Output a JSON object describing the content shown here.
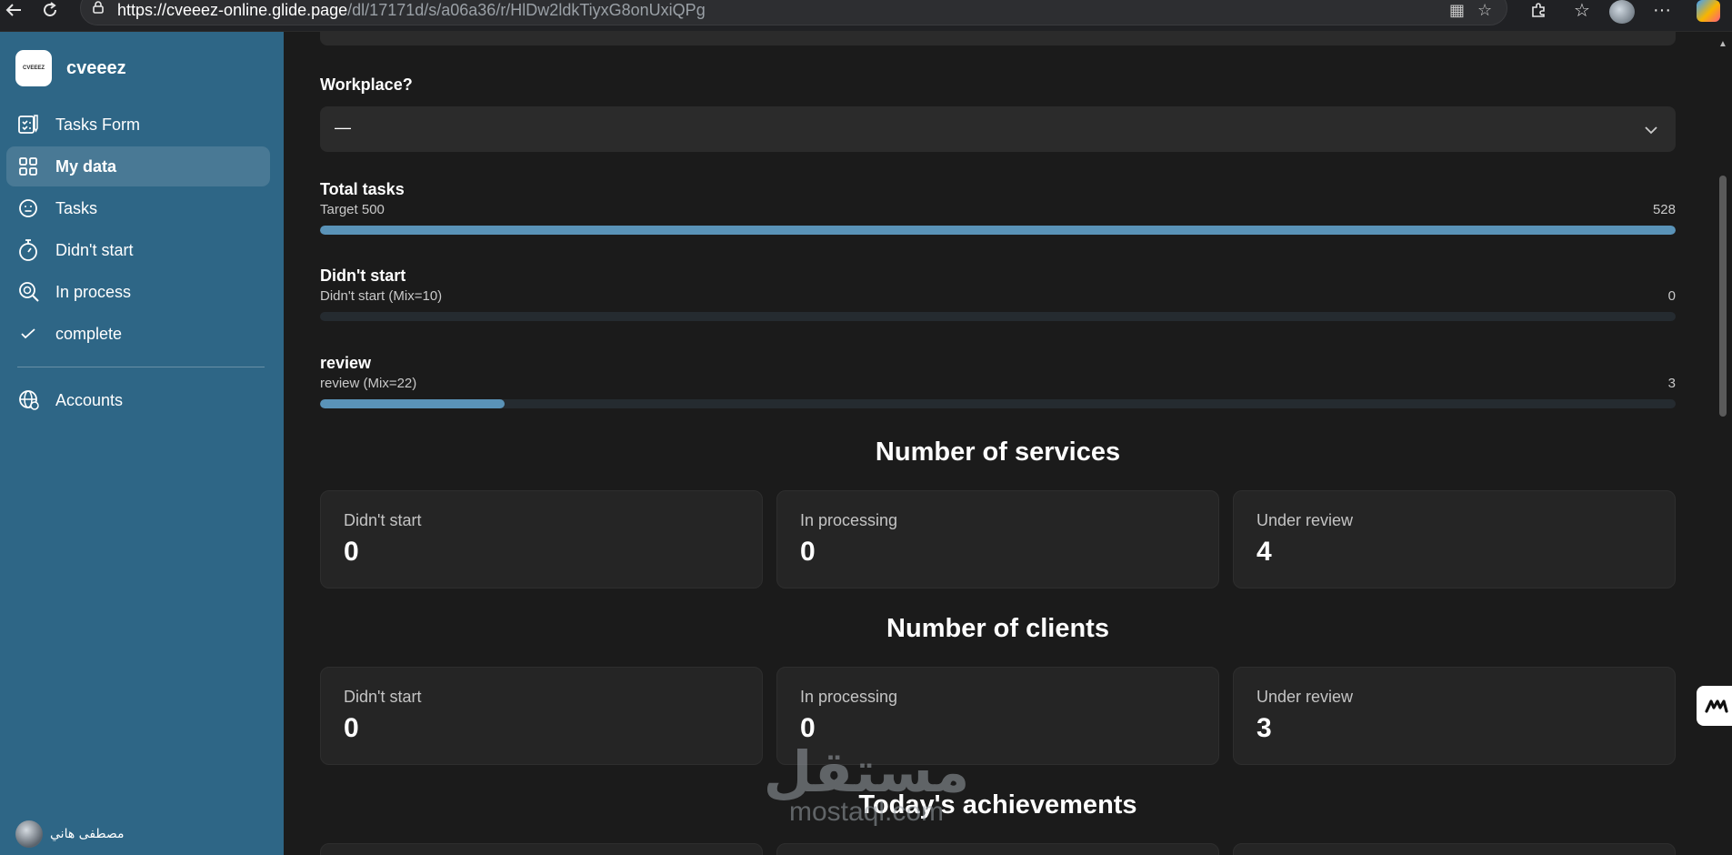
{
  "browser": {
    "url_host": "https://cveeez-online.glide.page",
    "url_path": "/dl/17171d/s/a06a36/r/HlDw2ldkTiyxG8onUxiQPg"
  },
  "app": {
    "logo_text": "CVEEEZ",
    "name": "cveeez"
  },
  "sidebar": {
    "items": [
      {
        "label": "Tasks Form",
        "icon": "form-icon"
      },
      {
        "label": "My data",
        "icon": "grid-icon"
      },
      {
        "label": "Tasks",
        "icon": "face-icon"
      },
      {
        "label": "Didn't start",
        "icon": "stopwatch-icon"
      },
      {
        "label": "In process",
        "icon": "search-icon"
      },
      {
        "label": "complete",
        "icon": "check-icon"
      },
      {
        "label": "Accounts",
        "icon": "globe-icon"
      }
    ],
    "active_index": 1,
    "user_name": "مصطفى هاني"
  },
  "form": {
    "workplace_label": "Workplace?",
    "workplace_value": "—"
  },
  "progress": [
    {
      "title": "Total tasks",
      "subtitle": "Target 500",
      "value": "528",
      "fraction": 1.0
    },
    {
      "title": "Didn't start",
      "subtitle": "Didn't start (Mix=10)",
      "value": "0",
      "fraction": 0.0
    },
    {
      "title": "review",
      "subtitle": "review (Mix=22)",
      "value": "3",
      "fraction": 0.136
    }
  ],
  "services": {
    "title": "Number of services",
    "cards": [
      {
        "label": "Didn't start",
        "value": "0"
      },
      {
        "label": "In processing",
        "value": "0"
      },
      {
        "label": "Under review",
        "value": "4"
      }
    ]
  },
  "clients": {
    "title": "Number of clients",
    "cards": [
      {
        "label": "Didn't start",
        "value": "0"
      },
      {
        "label": "In processing",
        "value": "0"
      },
      {
        "label": "Under review",
        "value": "3"
      }
    ]
  },
  "achievements": {
    "title": "Today's achievements"
  },
  "watermark": {
    "arabic": "مستقل",
    "latin": "mostaql.com"
  },
  "colors": {
    "sidebar": "#2e6686",
    "progress_fill": "#5a93b8",
    "background": "#1b1b1b"
  }
}
